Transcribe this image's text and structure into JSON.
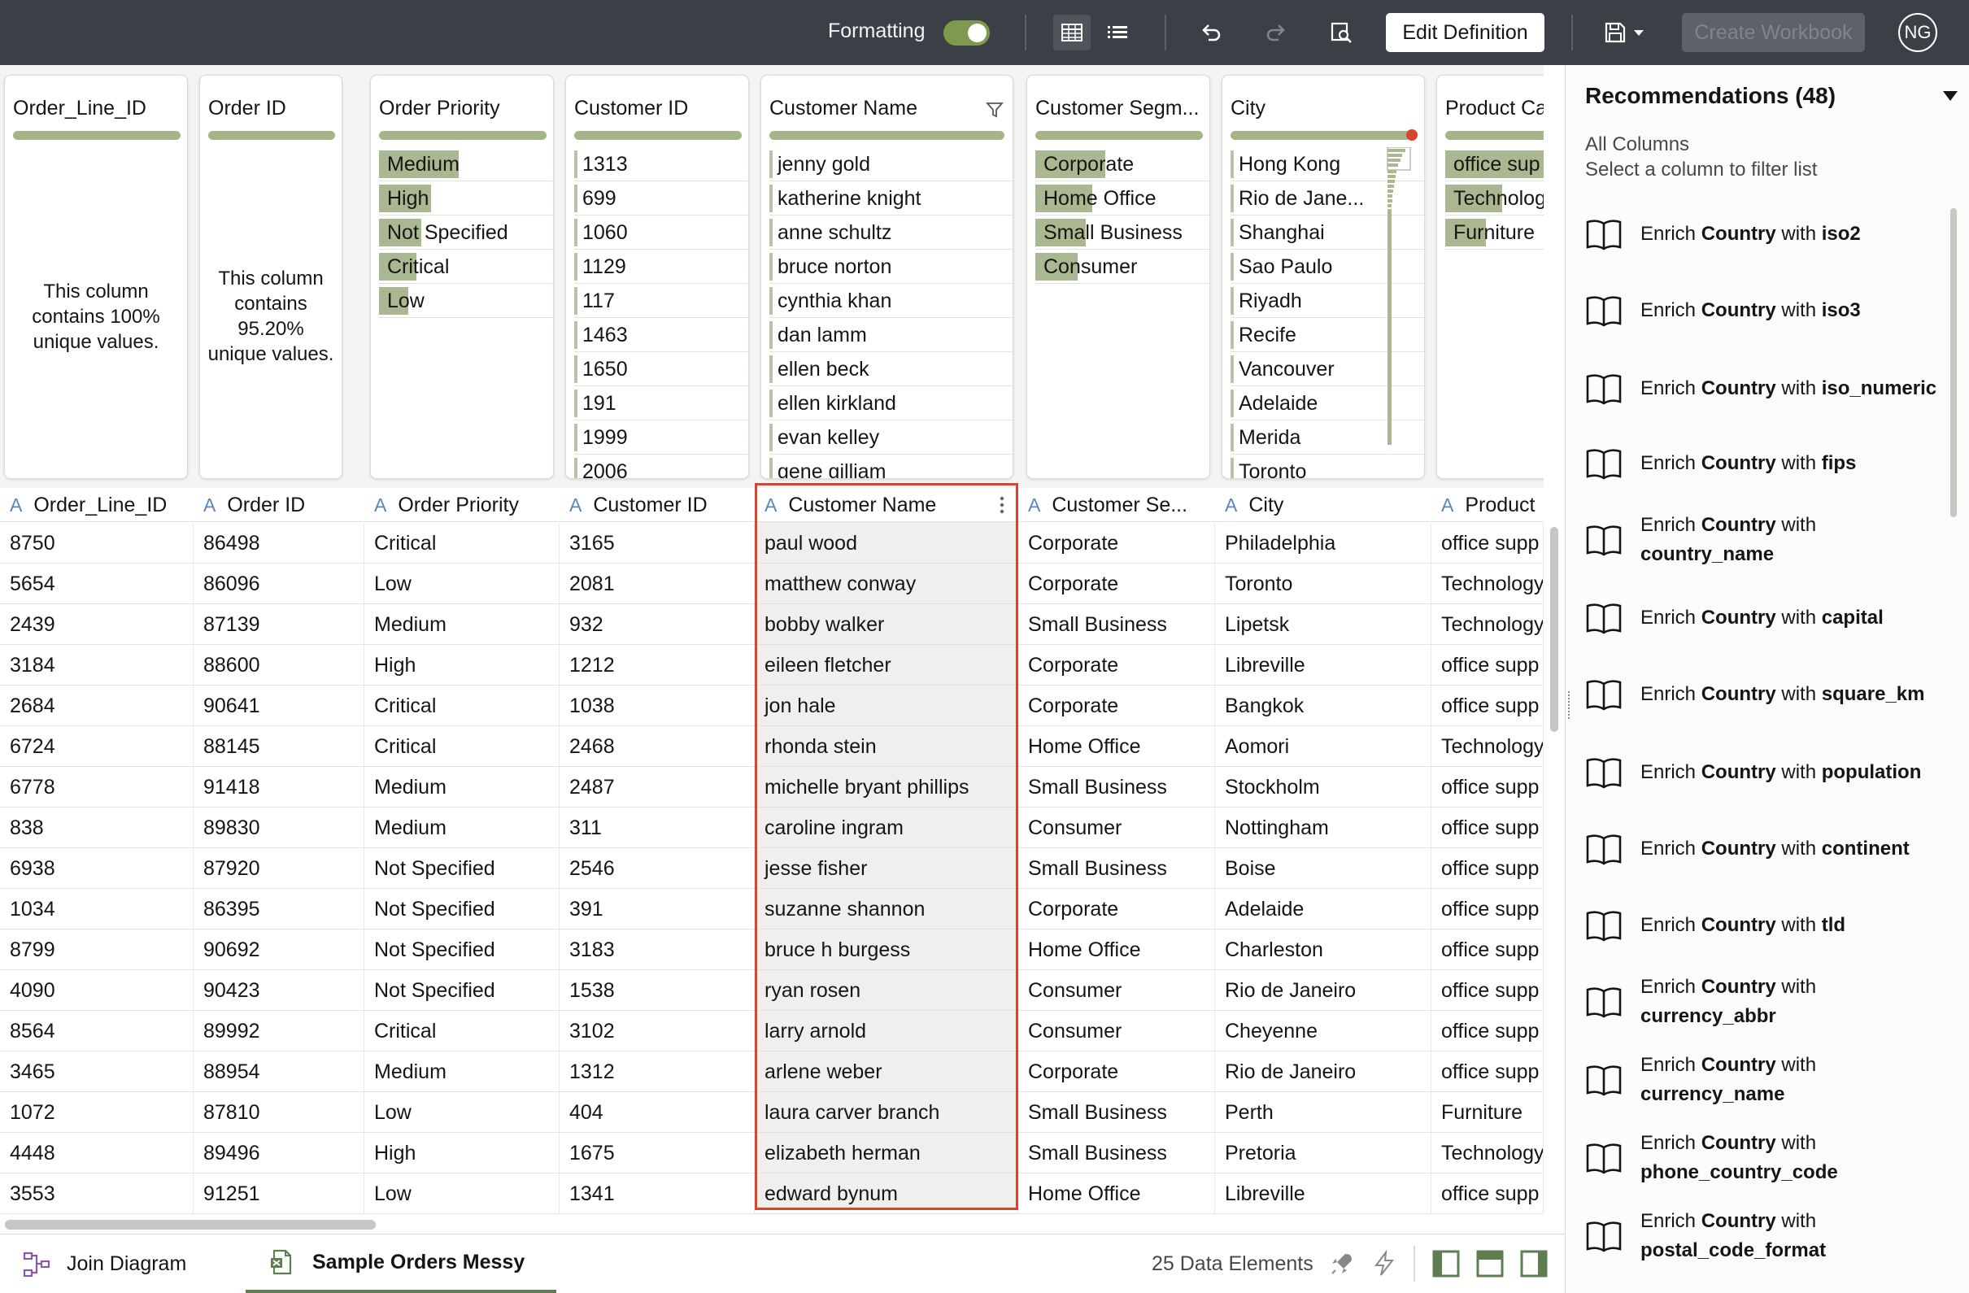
{
  "toolbar": {
    "formatting_label": "Formatting",
    "formatting_on": true,
    "edit_definition": "Edit Definition",
    "create_workbook": "Create Workbook",
    "user_initials": "NG"
  },
  "cards": {
    "c0": {
      "title": "Order_Line_ID",
      "note": "This column contains 100% unique values."
    },
    "c1": {
      "title": "Order ID",
      "note": "This column contains 95.20% unique values."
    },
    "c2": {
      "title": "Order Priority",
      "values": [
        "Medium",
        "High",
        "Not Specified",
        "Critical",
        "Low"
      ]
    },
    "c3": {
      "title": "Customer ID",
      "values": [
        "1313",
        "699",
        "1060",
        "1129",
        "117",
        "1463",
        "1650",
        "191",
        "1999",
        "2006"
      ]
    },
    "c4": {
      "title": "Customer Name",
      "values": [
        "jenny gold",
        "katherine knight",
        "anne schultz",
        "bruce norton",
        "cynthia khan",
        "dan lamm",
        "ellen beck",
        "ellen kirkland",
        "evan kelley",
        "gene gilliam"
      ]
    },
    "c5": {
      "title": "Customer Segm...",
      "values": [
        "Corporate",
        "Home Office",
        "Small Business",
        "Consumer"
      ]
    },
    "c6": {
      "title": "City",
      "values": [
        "Hong Kong",
        "Rio de Jane...",
        "Shanghai",
        "Sao Paulo",
        "Riyadh",
        "Recife",
        "Vancouver",
        "Adelaide",
        "Merida",
        "Toronto"
      ]
    },
    "c7": {
      "title": "Product Ca",
      "values": [
        "office sup",
        "Technolog",
        "Furniture"
      ]
    }
  },
  "grid": {
    "headers": [
      "Order_Line_ID",
      "Order ID",
      "Order Priority",
      "Customer ID",
      "Customer Name",
      "Customer Se...",
      "City",
      "Product"
    ],
    "type_glyph": "A",
    "rows": [
      [
        "8750",
        "86498",
        "Critical",
        "3165",
        "paul wood",
        "Corporate",
        "Philadelphia",
        "office supp"
      ],
      [
        "5654",
        "86096",
        "Low",
        "2081",
        "matthew conway",
        "Corporate",
        "Toronto",
        "Technology"
      ],
      [
        "2439",
        "87139",
        "Medium",
        "932",
        "bobby walker",
        "Small Business",
        "Lipetsk",
        "Technology"
      ],
      [
        "3184",
        "88600",
        "High",
        "1212",
        "eileen fletcher",
        "Corporate",
        "Libreville",
        "office supp"
      ],
      [
        "2684",
        "90641",
        "Critical",
        "1038",
        "jon hale",
        "Corporate",
        "Bangkok",
        "office supp"
      ],
      [
        "6724",
        "88145",
        "Critical",
        "2468",
        "rhonda stein",
        "Home Office",
        "Aomori",
        "Technology"
      ],
      [
        "6778",
        "91418",
        "Medium",
        "2487",
        "michelle bryant phillips",
        "Small Business",
        "Stockholm",
        "office supp"
      ],
      [
        "838",
        "89830",
        "Medium",
        "311",
        "caroline ingram",
        "Consumer",
        "Nottingham",
        "office supp"
      ],
      [
        "6938",
        "87920",
        "Not Specified",
        "2546",
        "jesse fisher",
        "Small Business",
        "Boise",
        "office supp"
      ],
      [
        "1034",
        "86395",
        "Not Specified",
        "391",
        "suzanne shannon",
        "Corporate",
        "Adelaide",
        "office supp"
      ],
      [
        "8799",
        "90692",
        "Not Specified",
        "3183",
        "bruce h burgess",
        "Home Office",
        "Charleston",
        "office supp"
      ],
      [
        "4090",
        "90423",
        "Not Specified",
        "1538",
        "ryan rosen",
        "Consumer",
        "Rio de Janeiro",
        "office supp"
      ],
      [
        "8564",
        "89992",
        "Critical",
        "3102",
        "larry arnold",
        "Consumer",
        "Cheyenne",
        "office supp"
      ],
      [
        "3465",
        "88954",
        "Medium",
        "1312",
        "arlene weber",
        "Corporate",
        "Rio de Janeiro",
        "office supp"
      ],
      [
        "1072",
        "87810",
        "Low",
        "404",
        "laura carver branch",
        "Small Business",
        "Perth",
        "Furniture"
      ],
      [
        "4448",
        "89496",
        "High",
        "1675",
        "elizabeth herman",
        "Small Business",
        "Pretoria",
        "Technology"
      ],
      [
        "3553",
        "91251",
        "Low",
        "1341",
        "edward bynum",
        "Home Office",
        "Libreville",
        "office supp"
      ]
    ]
  },
  "panel": {
    "title": "Recommendations (48)",
    "scope": "All Columns",
    "hint": "Select a column to filter list",
    "prefix": "Enrich",
    "column": "Country",
    "joiner": "with",
    "items": [
      "iso2",
      "iso3",
      "iso_numeric",
      "fips",
      "country_name",
      "capital",
      "square_km",
      "population",
      "continent",
      "tld",
      "currency_abbr",
      "currency_name",
      "phone_country_code",
      "postal_code_format"
    ]
  },
  "bottom": {
    "tab_join": "Join Diagram",
    "tab_dataset": "Sample Orders Messy",
    "elements": "25 Data Elements"
  },
  "colors": {
    "topbar": "#3a4046",
    "accent_green": "#a5b58a",
    "selection_border": "#d6452e",
    "type_glyph": "#5a86b8"
  }
}
